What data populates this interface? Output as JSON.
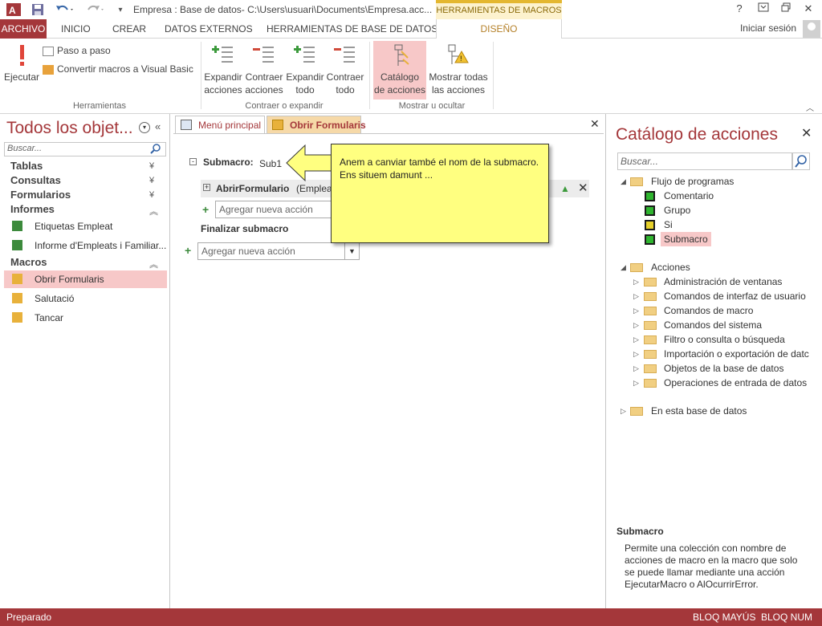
{
  "title": "Empresa : Base de datos- C:\\Users\\usuari\\Documents\\Empresa.acc...",
  "contextual_tab_group": "HERRAMIENTAS DE MACROS",
  "window_buttons": {
    "help": "?",
    "restore_ribbon": "⧉",
    "maximize": "🗗",
    "close": "✕"
  },
  "tabs": {
    "archivo": "ARCHIVO",
    "inicio": "INICIO",
    "crear": "CREAR",
    "datos_externos": "DATOS EXTERNOS",
    "herramientas_bd": "HERRAMIENTAS DE BASE DE DATOS",
    "diseno": "DISEÑO"
  },
  "signin": "Iniciar sesión",
  "ribbon": {
    "ejecutar": "Ejecutar",
    "paso_a_paso": "Paso a paso",
    "convertir": "Convertir macros a Visual Basic",
    "expandir_acciones_1": "Expandir",
    "expandir_acciones_2": "acciones",
    "contraer_acciones_1": "Contraer",
    "contraer_acciones_2": "acciones",
    "expandir_todo_1": "Expandir",
    "expandir_todo_2": "todo",
    "contraer_todo_1": "Contraer",
    "contraer_todo_2": "todo",
    "catalogo_1": "Catálogo",
    "catalogo_2": "de acciones",
    "mostrar_1": "Mostrar todas",
    "mostrar_2": "las acciones",
    "group_herramientas": "Herramientas",
    "group_contraer": "Contraer o expandir",
    "group_mostrar": "Mostrar u ocultar"
  },
  "nav": {
    "title": "Todos los objet...",
    "search_placeholder": "Buscar...",
    "categories": [
      "Tablas",
      "Consultas",
      "Formularios",
      "Informes",
      "Macros"
    ],
    "informes_items": [
      "Etiquetas Empleat",
      "Informe d'Empleats i Familiar..."
    ],
    "macros_items": [
      "Obrir Formularis",
      "Salutació",
      "Tancar"
    ]
  },
  "doc": {
    "tab1": "Menú principal",
    "tab2": "Obrir Formularis",
    "submacro_label": "Submacro:",
    "submacro_name": "Sub1",
    "action_name": "AbrirFormulario",
    "action_arg": "(Emplea",
    "add_action": "Agregar nueva acción",
    "end_submacro": "Finalizar submacro"
  },
  "callout": {
    "line1": "Anem a canviar també el nom de la submacro.",
    "line2": "Ens situem damunt ..."
  },
  "catalog": {
    "title": "Catálogo de acciones",
    "search_placeholder": "Buscar...",
    "flujo": "Flujo de programas",
    "flujo_items": [
      "Comentario",
      "Grupo",
      "Si",
      "Submacro"
    ],
    "acciones": "Acciones",
    "acciones_items": [
      "Administración de ventanas",
      "Comandos de interfaz de usuario",
      "Comandos de macro",
      "Comandos del sistema",
      "Filtro o consulta o búsqueda",
      "Importación o exportación de datc",
      "Objetos de la base de datos",
      "Operaciones de entrada de datos"
    ],
    "en_esta_bd": "En esta base de datos",
    "desc_title": "Submacro",
    "desc": "Permite una colección con nombre de acciones de macro en la macro que solo se puede llamar mediante una acción EjecutarMacro o AlOcurrirError."
  },
  "status": {
    "left": "Preparado",
    "caps": "BLOQ MAYÚS",
    "num": "BLOQ NUM"
  },
  "colors": {
    "accent": "#a4373a",
    "contextual": "#e4b730",
    "selection": "#f7c8c8",
    "callout": "#ffff80"
  }
}
